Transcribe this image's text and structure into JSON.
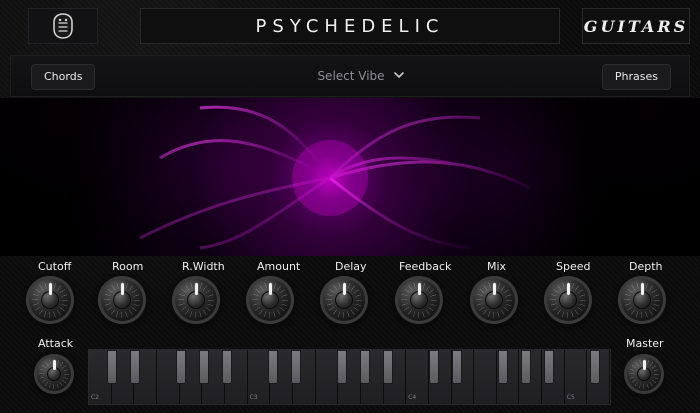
{
  "header": {
    "title": "PSYCHEDELIC",
    "brand": "GUITARS"
  },
  "controls": {
    "left_button": "Chords",
    "vibe_select": {
      "label": "Select Vibe"
    },
    "right_button": "Phrases"
  },
  "knobs": {
    "top": [
      "Cutoff",
      "Room",
      "R.Width",
      "Amount",
      "Delay",
      "Feedback",
      "Mix",
      "Speed",
      "Depth"
    ],
    "bottom_left": "Attack",
    "bottom_right": "Master"
  },
  "keyboard": {
    "note_labels": [
      "C2",
      "C3",
      "C4",
      "C5"
    ]
  },
  "colors": {
    "accent": "#d100ff",
    "background": "#0b0b0c"
  }
}
